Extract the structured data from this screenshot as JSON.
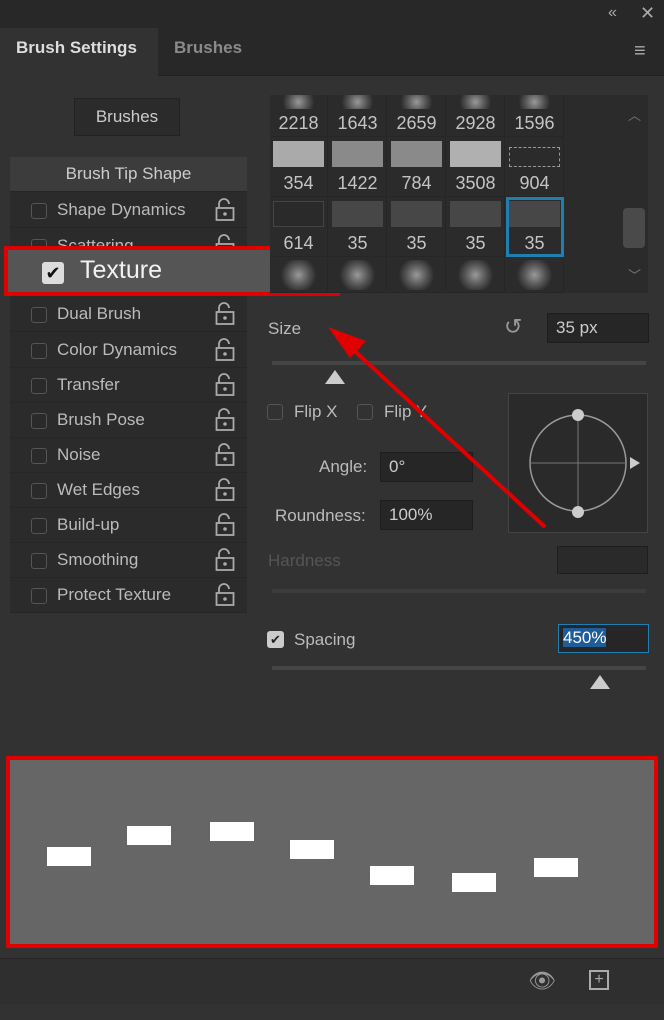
{
  "window": {
    "collapse_icon": "double-chevron-left",
    "close_icon": "close"
  },
  "tabs": [
    {
      "label": "Brush Settings",
      "active": true
    },
    {
      "label": "Brushes",
      "active": false
    }
  ],
  "brushes_button": "Brushes",
  "brush_tip_shape": "Brush Tip Shape",
  "options": [
    {
      "label": "Shape Dynamics",
      "checked": false
    },
    {
      "label": "Scattering",
      "checked": false
    },
    {
      "label": "Texture",
      "checked": true,
      "highlighted": true
    },
    {
      "label": "Dual Brush",
      "checked": false
    },
    {
      "label": "Color Dynamics",
      "checked": false
    },
    {
      "label": "Transfer",
      "checked": false
    },
    {
      "label": "Brush Pose",
      "checked": false
    },
    {
      "label": "Noise",
      "checked": false
    },
    {
      "label": "Wet Edges",
      "checked": false
    },
    {
      "label": "Build-up",
      "checked": false
    },
    {
      "label": "Smoothing",
      "checked": false
    },
    {
      "label": "Protect Texture",
      "checked": false
    }
  ],
  "presets": [
    [
      "2218",
      "1643",
      "2659",
      "2928",
      "1596"
    ],
    [
      "354",
      "1422",
      "784",
      "3508",
      "904"
    ],
    [
      "614",
      "35",
      "35",
      "35",
      "35"
    ],
    [
      "",
      "",
      "",
      "",
      ""
    ]
  ],
  "size": {
    "label": "Size",
    "value": "35 px"
  },
  "flip_x": "Flip X",
  "flip_y": "Flip Y",
  "angle": {
    "label": "Angle:",
    "value": "0°"
  },
  "roundness": {
    "label": "Roundness:",
    "value": "100%"
  },
  "hardness": {
    "label": "Hardness"
  },
  "spacing": {
    "label": "Spacing",
    "value": "450%",
    "checked": true
  },
  "colors": {
    "highlight": "#e00000",
    "selected": "#1e7fb0"
  }
}
